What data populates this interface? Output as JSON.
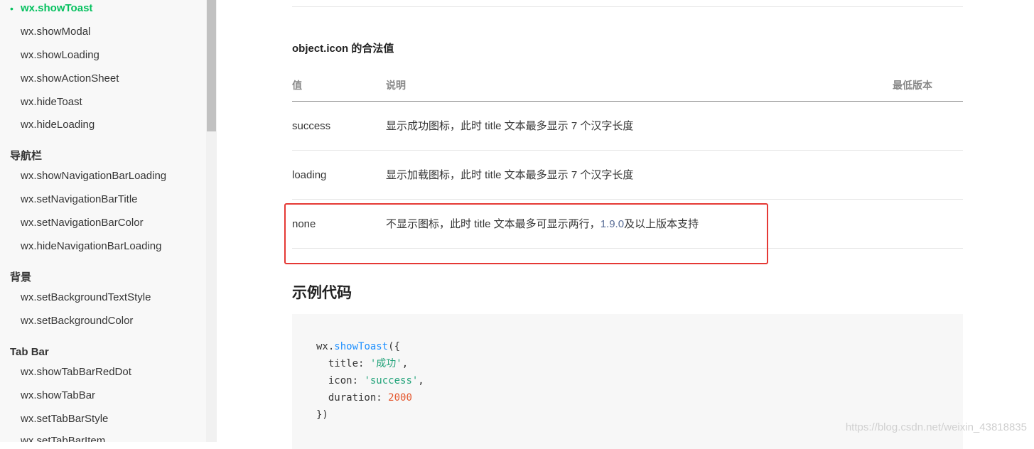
{
  "sidebar": {
    "items": [
      {
        "label": "wx.showToast",
        "active": true
      },
      {
        "label": "wx.showModal"
      },
      {
        "label": "wx.showLoading"
      },
      {
        "label": "wx.showActionSheet"
      },
      {
        "label": "wx.hideToast"
      },
      {
        "label": "wx.hideLoading"
      },
      {
        "section": "导航栏"
      },
      {
        "label": "wx.showNavigationBarLoading"
      },
      {
        "label": "wx.setNavigationBarTitle"
      },
      {
        "label": "wx.setNavigationBarColor"
      },
      {
        "label": "wx.hideNavigationBarLoading"
      },
      {
        "section": "背景"
      },
      {
        "label": "wx.setBackgroundTextStyle"
      },
      {
        "label": "wx.setBackgroundColor"
      },
      {
        "section": "Tab Bar"
      },
      {
        "label": "wx.showTabBarRedDot"
      },
      {
        "label": "wx.showTabBar"
      },
      {
        "label": "wx.setTabBarStyle"
      },
      {
        "label": "wx.setTabBarItem"
      }
    ],
    "bullet": "•"
  },
  "main": {
    "section_title": "object.icon 的合法值",
    "table": {
      "headers": [
        "值",
        "说明",
        "最低版本"
      ],
      "rows": [
        {
          "value": "success",
          "desc": "显示成功图标，此时 title 文本最多显示 7 个汉字长度"
        },
        {
          "value": "loading",
          "desc": "显示加载图标，此时 title 文本最多显示 7 个汉字长度"
        },
        {
          "value": "none",
          "desc_prefix": "不显示图标，此时 title 文本最多可显示两行，",
          "desc_link": "1.9.0",
          "desc_suffix": "及以上版本支持"
        }
      ]
    },
    "code_heading": "示例代码",
    "code": {
      "l1_obj": "wx.",
      "l1_fn": "showToast",
      "l1_end": "({",
      "l2_key": "  title: ",
      "l2_str": "'成功'",
      "l2_end": ",",
      "l3_key": "  icon: ",
      "l3_str": "'success'",
      "l3_end": ",",
      "l4_key": "  duration: ",
      "l4_num": "2000",
      "l5": "})"
    }
  },
  "watermark": "https://blog.csdn.net/weixin_43818835",
  "colors": {
    "accent": "#07c160",
    "link": "#576b95",
    "highlight": "#e53935"
  }
}
